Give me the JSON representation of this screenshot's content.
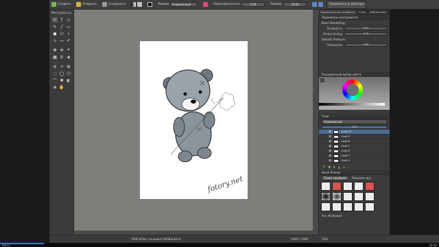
{
  "toolbar": {
    "create_label": "Создать",
    "open_label": "Открыть",
    "save_label": "Сохранить",
    "mode_label": "Режим",
    "blend_mode": "Нормальный",
    "opacity_label": "Непрозрачность",
    "opacity_value": "0.56",
    "size_label": "Размер",
    "size_value": "10.00",
    "workspace_button": "Сохранить в палитре"
  },
  "toolbox": {
    "title": "Инструменты"
  },
  "docker": {
    "tabs": [
      "Параметры инструмента",
      "Слои",
      "Библиотека"
    ],
    "tool_options_title": "Параметры инструмента",
    "basic_smoothing_label": "Basic Smoothing",
    "smoothness_label": "Плавность",
    "smoothness_value": "50.0",
    "stroke_ending_label": "Stroke Ending",
    "stroke_ending_value": "0.15",
    "smooth_pressure_label": "Smooth Pressure",
    "assistant_label": "Помощник",
    "assistant_value": "1.00",
    "color_selector_title": "Расширенный выбор цвета",
    "layers_title": "Слои",
    "blend_mode": "Нормальный",
    "opacity_value": "100",
    "layers": [
      "Слой 10",
      "Слой 9",
      "Слой 8",
      "Слой 7",
      "Слой 6",
      "Слой 5",
      "Слой 4"
    ],
    "brush_presets_title": "Brush Presets",
    "brush_filter_label": "Поиск профиля",
    "show_in_palette_label": "Показать вср",
    "brush_tag_label": "Ara. Названия"
  },
  "canvas": {
    "watermark": "fotory.net"
  },
  "statusbar": {
    "color_profile": "RGB (8-бит на канал)  sRGB-built-in",
    "dimensions": "1000 x 1500",
    "zoom": "32%"
  },
  "player": {
    "elapsed": "03:13",
    "total": "14:50",
    "progress": 0.1
  },
  "colors": {
    "selected_layer": "#4d6e93",
    "progress": "#3a7bd5",
    "canvas_bg": "#7e7e7a"
  }
}
